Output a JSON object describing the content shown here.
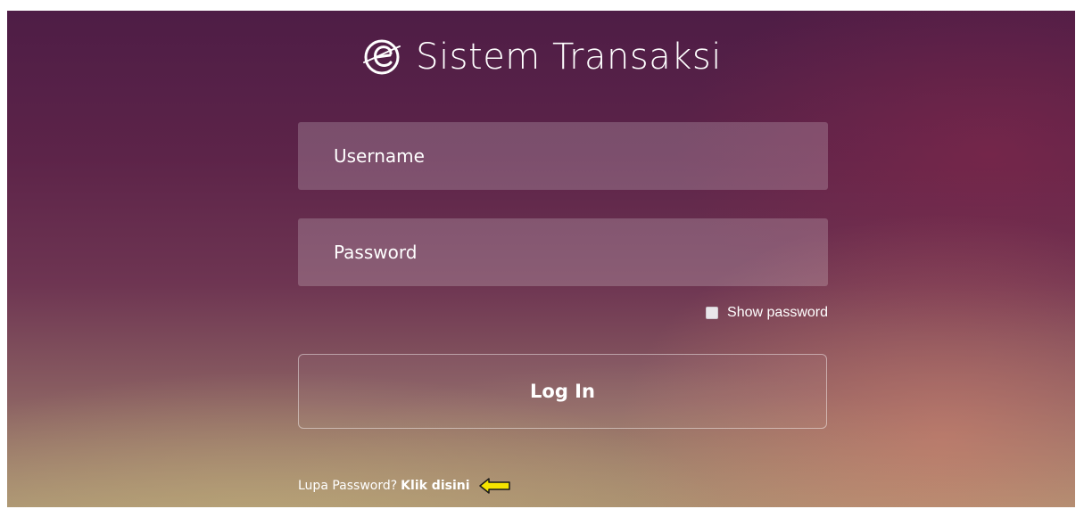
{
  "app": {
    "title": "Sistem Transaksi",
    "logo_icon": "e-globe-logo-icon"
  },
  "form": {
    "username_placeholder": "Username",
    "password_placeholder": "Password",
    "show_password_label": "Show password",
    "show_password_checked": false,
    "login_label": "Log In"
  },
  "forgot": {
    "prompt": "Lupa Password?",
    "link_label": "Klik disini",
    "pointer_icon": "left-arrow-icon",
    "pointer_color": "#f5e400"
  },
  "colors": {
    "background_top": "#4e1d46",
    "background_bottom": "#a99273",
    "text": "#ffffff"
  }
}
